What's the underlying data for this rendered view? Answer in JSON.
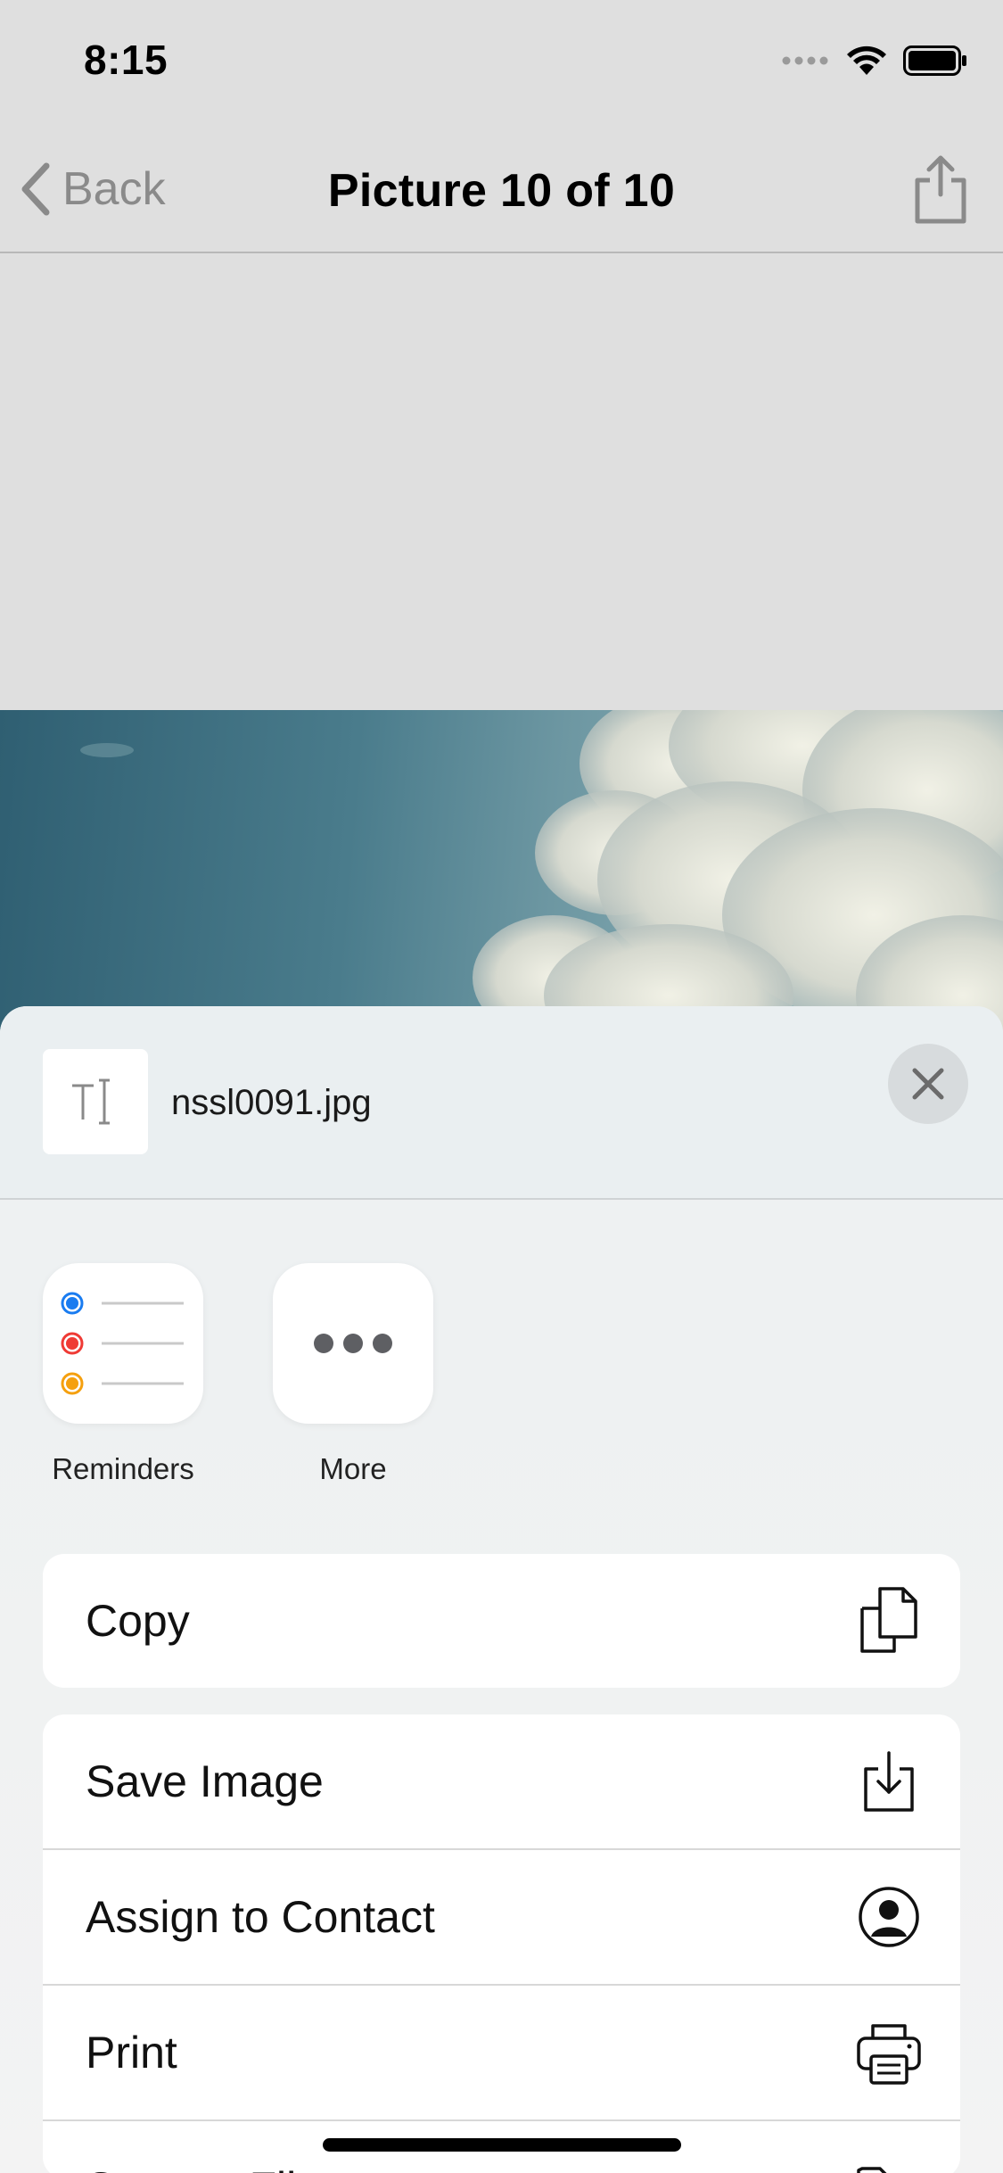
{
  "status_bar": {
    "time": "8:15"
  },
  "nav": {
    "back_label": "Back",
    "title": "Picture 10 of 10"
  },
  "share_sheet": {
    "file_name": "nssl0091.jpg",
    "apps": [
      {
        "label": "Reminders",
        "icon": "reminders-icon"
      },
      {
        "label": "More",
        "icon": "more-icon"
      }
    ],
    "actions": [
      {
        "label": "Copy",
        "icon": "copy-icon"
      },
      {
        "label": "Save Image",
        "icon": "save-image-icon"
      },
      {
        "label": "Assign to Contact",
        "icon": "contact-icon"
      },
      {
        "label": "Print",
        "icon": "print-icon"
      },
      {
        "label": "Save to Files",
        "icon": "folder-icon"
      }
    ]
  },
  "colors": {
    "reminder_blue": "#1a7cf0",
    "reminder_red": "#ef3b35",
    "reminder_orange": "#f5a00f"
  }
}
